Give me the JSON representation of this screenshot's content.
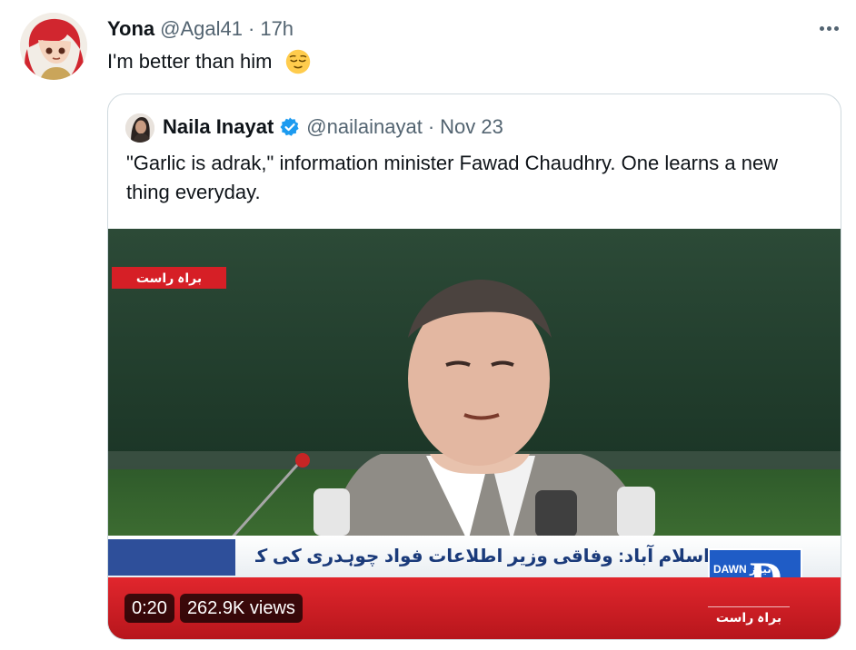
{
  "tweet": {
    "display_name": "Yona",
    "handle": "@Agal41",
    "separator": "·",
    "time": "17h",
    "text": "I'm better than him",
    "emoji": "relieved-face-emoji",
    "more_icon": "more-options-icon"
  },
  "quote": {
    "display_name": "Naila Inayat",
    "verified_icon": "verified-badge-icon",
    "handle": "@nailainayat",
    "separator": "·",
    "date": "Nov 23",
    "text": "\"Garlic is adrak,\" information minister Fawad Chaudhry. One learns a new thing everyday.",
    "video": {
      "elapsed": "0:20",
      "views": "262.9K views",
      "live_tag": "براہ راست",
      "ticker": "اسلام آباد: وفاقی وزیر اطلاعات فواد چوہدری کی کابینہ اجلاس پر بریفنگ",
      "channel_logo_small": "DAWN\nنیوز",
      "channel_logo_big": "D",
      "bottom_tag": "براہ راست"
    }
  },
  "colors": {
    "text_primary": "#0f1419",
    "text_secondary": "#536471",
    "border": "#cfd9de",
    "verified_blue": "#1d9bf0",
    "live_red": "#d61f26"
  }
}
